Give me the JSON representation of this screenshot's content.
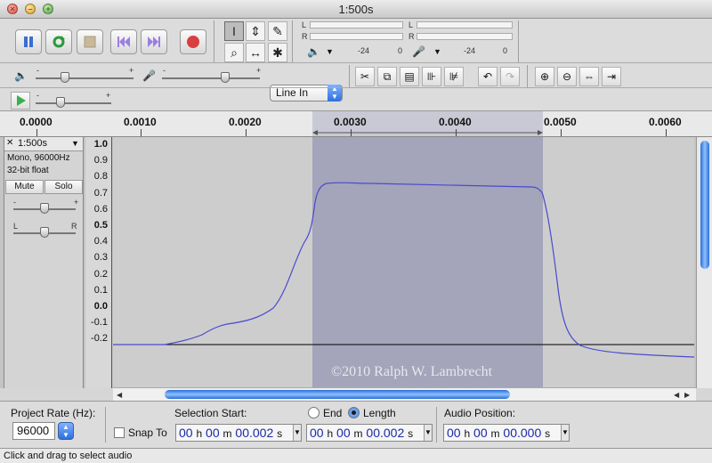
{
  "window": {
    "title": "1:500s"
  },
  "toolbar": {
    "level_meter_ticks": [
      "-24",
      "0",
      "-24",
      "0"
    ],
    "meter_channels": [
      "L",
      "R",
      "L",
      "R"
    ],
    "input_source": "Line In",
    "tools": {
      "selection": "I",
      "envelope": "⇕",
      "draw": "✎",
      "zoom": "⌕",
      "timeshift": "↔",
      "multi": "✱"
    }
  },
  "ruler": {
    "ticks": [
      "0.0000",
      "0.0010",
      "0.0020",
      "0.0030",
      "0.0040",
      "0.0050",
      "0.0060"
    ]
  },
  "track": {
    "name": "1:500s",
    "format": "Mono, 96000Hz",
    "bit_depth": "32-bit float",
    "mute_label": "Mute",
    "solo_label": "Solo",
    "gain_labels": [
      "-",
      "+"
    ],
    "pan_labels": [
      "L",
      "R"
    ],
    "vruler": [
      "1.0",
      "0.9",
      "0.8",
      "0.7",
      "0.6",
      "0.5",
      "0.4",
      "0.3",
      "0.2",
      "0.1",
      "0.0",
      "-0.1",
      "-0.2"
    ],
    "watermark": "©2010  Ralph W. Lambrecht",
    "waveform_color": "#4a4ad0",
    "selection_color": "#a4a4ba",
    "background_color": "#cdcdcd"
  },
  "selection_bar": {
    "project_rate_label": "Project Rate (Hz):",
    "project_rate": "96000",
    "snap_to_label": "Snap To",
    "selection_start_label": "Selection Start:",
    "end_label": "End",
    "length_label": "Length",
    "audio_position_label": "Audio Position:",
    "start_time": {
      "h": "00",
      "m": "00",
      "s": "00.002"
    },
    "length_time": {
      "h": "00",
      "m": "00",
      "s": "00.002"
    },
    "position_time": {
      "h": "00",
      "m": "00",
      "s": "00.000"
    },
    "h_unit": "h",
    "m_unit": "m",
    "s_unit": "s"
  },
  "status": {
    "text": "Click and drag to select audio"
  }
}
